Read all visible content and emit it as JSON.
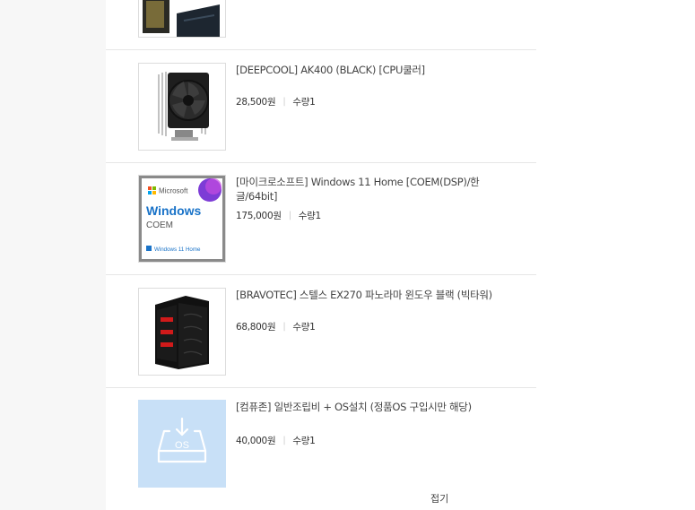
{
  "items": [
    {
      "name": "[DEEPCOOL] AK400 (BLACK) [CPU쿨러]",
      "price": "28,500원",
      "qty": "수량1",
      "icon": "cpu-cooler-icon"
    },
    {
      "name": "[마이크로소프트] Windows 11 Home [COEM(DSP)/한글/64bit]",
      "price": "175,000원",
      "qty": "수량1",
      "icon": "windows-box-icon",
      "box": {
        "brand": "Microsoft",
        "product": "Windows",
        "edition": "COEM",
        "footer": "Windows 11 Home"
      }
    },
    {
      "name": "[BRAVOTEC] 스텔스 EX270 파노라마 윈도우 블랙 (빅타워)",
      "price": "68,800원",
      "qty": "수량1",
      "icon": "pc-case-icon"
    },
    {
      "name": "[컴퓨존] 일반조립비 + OS설치 (정품OS 구입시만 해당)",
      "price": "40,000원",
      "qty": "수량1",
      "icon": "os-install-icon",
      "badge": "OS"
    }
  ],
  "fold_label": "접기",
  "colors": {
    "separator": "#e6e6e6",
    "thumb_border": "#dcdcdc",
    "os_tile": "#c8e0f7",
    "windows_blue": "#1a73c8"
  }
}
